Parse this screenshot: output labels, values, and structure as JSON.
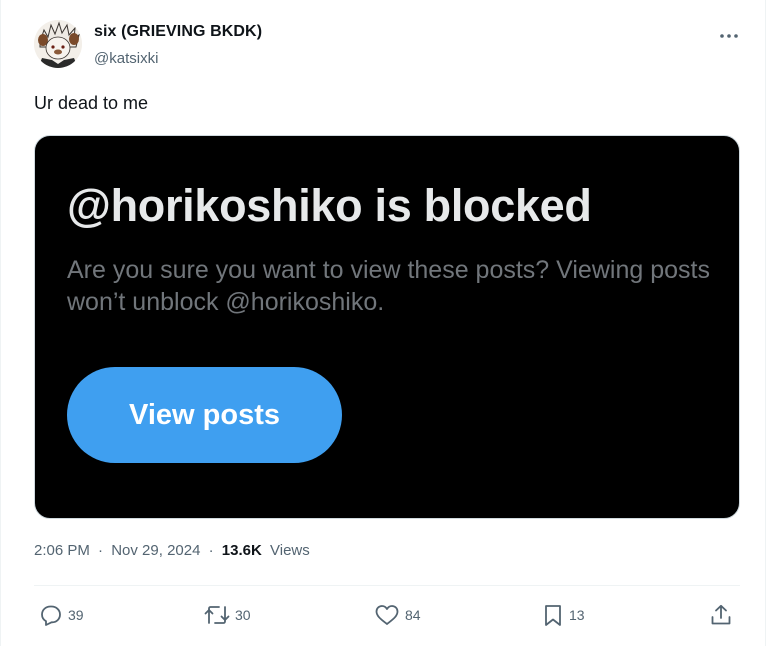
{
  "author": {
    "display_name": "six (GRIEVING BKDK)",
    "handle": "@katsixki"
  },
  "tweet": {
    "text": "Ur dead to me"
  },
  "media": {
    "title": "@horikoshiko is blocked",
    "description": "Are you sure you want to view these posts? Viewing posts won’t unblock @horikoshiko.",
    "button_label": "View posts"
  },
  "meta": {
    "time": "2:06 PM",
    "date": "Nov 29, 2024",
    "separator": "·",
    "views_count": "13.6K",
    "views_label": "Views"
  },
  "actions": {
    "replies": "39",
    "reposts": "30",
    "likes": "84",
    "bookmarks": "13"
  },
  "icons": {
    "more": "more-horizontal-icon",
    "reply": "reply-icon",
    "repost": "repost-icon",
    "like": "heart-icon",
    "bookmark": "bookmark-icon",
    "share": "share-icon"
  },
  "colors": {
    "text_primary": "#0f1419",
    "text_secondary": "#536471",
    "card_background": "#000000",
    "card_title": "#e7e9ea",
    "card_description": "#71767b",
    "button_blue": "#3f9ff0"
  }
}
